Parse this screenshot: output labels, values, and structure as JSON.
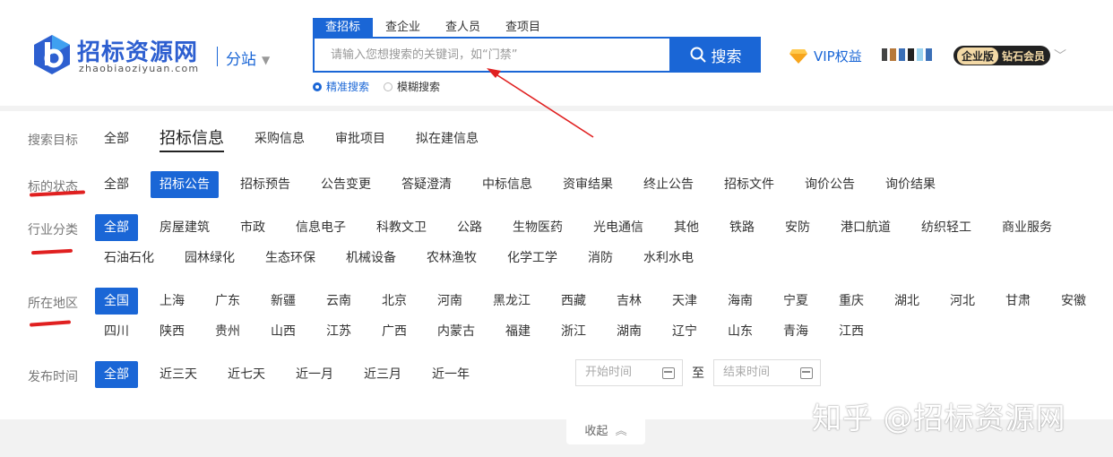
{
  "header": {
    "logo_text": "招标资源网",
    "logo_sub": "zhaobiaoziyuan.com",
    "branch_label": "分站",
    "search_tabs": [
      "查招标",
      "查企业",
      "查人员",
      "查项目"
    ],
    "search_placeholder": "请输入您想搜索的关键词，如“门禁”",
    "search_button": "搜索",
    "modes": [
      "精准搜索",
      "模糊搜索"
    ],
    "vip_label": "VIP权益",
    "member_edition": "企业版",
    "member_level": "钻石会员"
  },
  "filters": {
    "target": {
      "label": "搜索目标",
      "options": [
        "全部",
        "招标信息",
        "采购信息",
        "审批项目",
        "拟在建信息"
      ]
    },
    "status": {
      "label": "标的状态",
      "options": [
        "全部",
        "招标公告",
        "招标预告",
        "公告变更",
        "答疑澄清",
        "中标信息",
        "资审结果",
        "终止公告",
        "招标文件",
        "询价公告",
        "询价结果"
      ]
    },
    "industry": {
      "label": "行业分类",
      "options": [
        "全部",
        "房屋建筑",
        "市政",
        "信息电子",
        "科教文卫",
        "公路",
        "生物医药",
        "光电通信",
        "其他",
        "铁路",
        "安防",
        "港口航道",
        "纺织轻工",
        "商业服务",
        "石油石化",
        "园林绿化",
        "生态环保",
        "机械设备",
        "农林渔牧",
        "化学工学",
        "消防",
        "水利水电"
      ]
    },
    "region": {
      "label": "所在地区",
      "options": [
        "全国",
        "上海",
        "广东",
        "新疆",
        "云南",
        "北京",
        "河南",
        "黑龙江",
        "西藏",
        "吉林",
        "天津",
        "海南",
        "宁夏",
        "重庆",
        "湖北",
        "河北",
        "甘肃",
        "安徽",
        "四川",
        "陕西",
        "贵州",
        "山西",
        "江苏",
        "广西",
        "内蒙古",
        "福建",
        "浙江",
        "湖南",
        "辽宁",
        "山东",
        "青海",
        "江西"
      ]
    },
    "time": {
      "label": "发布时间",
      "options": [
        "全部",
        "近三天",
        "近七天",
        "近一月",
        "近三月",
        "近一年"
      ],
      "start_placeholder": "开始时间",
      "to_label": "至",
      "end_placeholder": "结束时间"
    }
  },
  "collapse_label": "收起",
  "watermark": "知乎 @招标资源网",
  "colors": {
    "accent": "#1a66d6",
    "annotation": "#e02020"
  }
}
